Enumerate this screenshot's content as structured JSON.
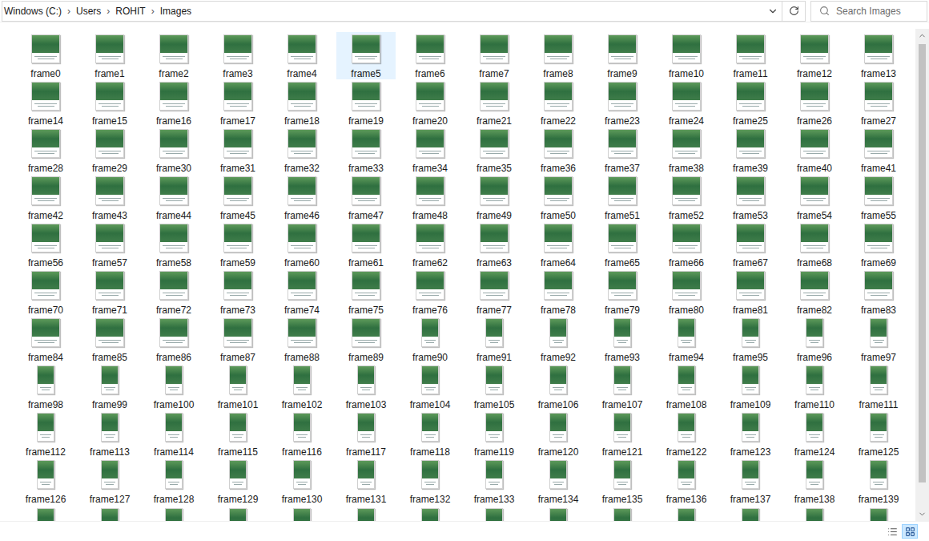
{
  "address_bar": {
    "path": [
      {
        "label": "Windows (C:)"
      },
      {
        "label": "Users"
      },
      {
        "label": "ROHIT"
      },
      {
        "label": "Images"
      }
    ],
    "separator": "›"
  },
  "search": {
    "placeholder": "Search Images"
  },
  "items": [
    {
      "name": "frame0",
      "kind": "landscape",
      "selected": false
    },
    {
      "name": "frame1",
      "kind": "landscape",
      "selected": false
    },
    {
      "name": "frame2",
      "kind": "landscape",
      "selected": false
    },
    {
      "name": "frame3",
      "kind": "landscape",
      "selected": false
    },
    {
      "name": "frame4",
      "kind": "landscape",
      "selected": false
    },
    {
      "name": "frame5",
      "kind": "landscape",
      "selected": true
    },
    {
      "name": "frame6",
      "kind": "landscape",
      "selected": false
    },
    {
      "name": "frame7",
      "kind": "landscape",
      "selected": false
    },
    {
      "name": "frame8",
      "kind": "landscape",
      "selected": false
    },
    {
      "name": "frame9",
      "kind": "landscape",
      "selected": false
    },
    {
      "name": "frame10",
      "kind": "landscape",
      "selected": false
    },
    {
      "name": "frame11",
      "kind": "landscape",
      "selected": false
    },
    {
      "name": "frame12",
      "kind": "landscape",
      "selected": false
    },
    {
      "name": "frame13",
      "kind": "landscape",
      "selected": false
    },
    {
      "name": "frame14",
      "kind": "landscape",
      "selected": false
    },
    {
      "name": "frame15",
      "kind": "landscape",
      "selected": false
    },
    {
      "name": "frame16",
      "kind": "landscape",
      "selected": false
    },
    {
      "name": "frame17",
      "kind": "landscape",
      "selected": false
    },
    {
      "name": "frame18",
      "kind": "landscape",
      "selected": false
    },
    {
      "name": "frame19",
      "kind": "landscape",
      "selected": false
    },
    {
      "name": "frame20",
      "kind": "landscape",
      "selected": false
    },
    {
      "name": "frame21",
      "kind": "landscape",
      "selected": false
    },
    {
      "name": "frame22",
      "kind": "landscape",
      "selected": false
    },
    {
      "name": "frame23",
      "kind": "landscape",
      "selected": false
    },
    {
      "name": "frame24",
      "kind": "landscape",
      "selected": false
    },
    {
      "name": "frame25",
      "kind": "landscape",
      "selected": false
    },
    {
      "name": "frame26",
      "kind": "landscape",
      "selected": false
    },
    {
      "name": "frame27",
      "kind": "landscape",
      "selected": false
    },
    {
      "name": "frame28",
      "kind": "landscape",
      "selected": false
    },
    {
      "name": "frame29",
      "kind": "landscape",
      "selected": false
    },
    {
      "name": "frame30",
      "kind": "landscape",
      "selected": false
    },
    {
      "name": "frame31",
      "kind": "landscape",
      "selected": false
    },
    {
      "name": "frame32",
      "kind": "landscape",
      "selected": false
    },
    {
      "name": "frame33",
      "kind": "landscape",
      "selected": false
    },
    {
      "name": "frame34",
      "kind": "landscape",
      "selected": false
    },
    {
      "name": "frame35",
      "kind": "landscape",
      "selected": false
    },
    {
      "name": "frame36",
      "kind": "landscape",
      "selected": false
    },
    {
      "name": "frame37",
      "kind": "landscape",
      "selected": false
    },
    {
      "name": "frame38",
      "kind": "landscape",
      "selected": false
    },
    {
      "name": "frame39",
      "kind": "landscape",
      "selected": false
    },
    {
      "name": "frame40",
      "kind": "landscape",
      "selected": false
    },
    {
      "name": "frame41",
      "kind": "landscape",
      "selected": false
    },
    {
      "name": "frame42",
      "kind": "landscape",
      "selected": false
    },
    {
      "name": "frame43",
      "kind": "landscape",
      "selected": false
    },
    {
      "name": "frame44",
      "kind": "landscape",
      "selected": false
    },
    {
      "name": "frame45",
      "kind": "landscape",
      "selected": false
    },
    {
      "name": "frame46",
      "kind": "landscape",
      "selected": false
    },
    {
      "name": "frame47",
      "kind": "landscape",
      "selected": false
    },
    {
      "name": "frame48",
      "kind": "landscape",
      "selected": false
    },
    {
      "name": "frame49",
      "kind": "landscape",
      "selected": false
    },
    {
      "name": "frame50",
      "kind": "landscape",
      "selected": false
    },
    {
      "name": "frame51",
      "kind": "landscape",
      "selected": false
    },
    {
      "name": "frame52",
      "kind": "landscape",
      "selected": false
    },
    {
      "name": "frame53",
      "kind": "landscape",
      "selected": false
    },
    {
      "name": "frame54",
      "kind": "landscape",
      "selected": false
    },
    {
      "name": "frame55",
      "kind": "landscape",
      "selected": false
    },
    {
      "name": "frame56",
      "kind": "landscape",
      "selected": false
    },
    {
      "name": "frame57",
      "kind": "landscape",
      "selected": false
    },
    {
      "name": "frame58",
      "kind": "landscape",
      "selected": false
    },
    {
      "name": "frame59",
      "kind": "landscape",
      "selected": false
    },
    {
      "name": "frame60",
      "kind": "landscape",
      "selected": false
    },
    {
      "name": "frame61",
      "kind": "landscape",
      "selected": false
    },
    {
      "name": "frame62",
      "kind": "landscape",
      "selected": false
    },
    {
      "name": "frame63",
      "kind": "landscape",
      "selected": false
    },
    {
      "name": "frame64",
      "kind": "landscape",
      "selected": false
    },
    {
      "name": "frame65",
      "kind": "landscape",
      "selected": false
    },
    {
      "name": "frame66",
      "kind": "landscape",
      "selected": false
    },
    {
      "name": "frame67",
      "kind": "landscape",
      "selected": false
    },
    {
      "name": "frame68",
      "kind": "landscape",
      "selected": false
    },
    {
      "name": "frame69",
      "kind": "landscape",
      "selected": false
    },
    {
      "name": "frame70",
      "kind": "landscape",
      "selected": false
    },
    {
      "name": "frame71",
      "kind": "landscape",
      "selected": false
    },
    {
      "name": "frame72",
      "kind": "landscape",
      "selected": false
    },
    {
      "name": "frame73",
      "kind": "landscape",
      "selected": false
    },
    {
      "name": "frame74",
      "kind": "landscape",
      "selected": false
    },
    {
      "name": "frame75",
      "kind": "landscape",
      "selected": false
    },
    {
      "name": "frame76",
      "kind": "landscape",
      "selected": false
    },
    {
      "name": "frame77",
      "kind": "landscape",
      "selected": false
    },
    {
      "name": "frame78",
      "kind": "landscape",
      "selected": false
    },
    {
      "name": "frame79",
      "kind": "landscape",
      "selected": false
    },
    {
      "name": "frame80",
      "kind": "landscape",
      "selected": false
    },
    {
      "name": "frame81",
      "kind": "landscape",
      "selected": false
    },
    {
      "name": "frame82",
      "kind": "landscape",
      "selected": false
    },
    {
      "name": "frame83",
      "kind": "landscape",
      "selected": false
    },
    {
      "name": "frame84",
      "kind": "landscape",
      "selected": false
    },
    {
      "name": "frame85",
      "kind": "landscape",
      "selected": false
    },
    {
      "name": "frame86",
      "kind": "landscape",
      "selected": false
    },
    {
      "name": "frame87",
      "kind": "landscape",
      "selected": false
    },
    {
      "name": "frame88",
      "kind": "landscape",
      "selected": false
    },
    {
      "name": "frame89",
      "kind": "landscape",
      "selected": false
    },
    {
      "name": "frame90",
      "kind": "portrait",
      "selected": false
    },
    {
      "name": "frame91",
      "kind": "portrait",
      "selected": false
    },
    {
      "name": "frame92",
      "kind": "portrait",
      "selected": false
    },
    {
      "name": "frame93",
      "kind": "portrait",
      "selected": false
    },
    {
      "name": "frame94",
      "kind": "portrait",
      "selected": false
    },
    {
      "name": "frame95",
      "kind": "portrait",
      "selected": false
    },
    {
      "name": "frame96",
      "kind": "portrait",
      "selected": false
    },
    {
      "name": "frame97",
      "kind": "portrait",
      "selected": false
    },
    {
      "name": "frame98",
      "kind": "portrait",
      "selected": false
    },
    {
      "name": "frame99",
      "kind": "portrait",
      "selected": false
    },
    {
      "name": "frame100",
      "kind": "portrait",
      "selected": false
    },
    {
      "name": "frame101",
      "kind": "portrait",
      "selected": false
    },
    {
      "name": "frame102",
      "kind": "portrait",
      "selected": false
    },
    {
      "name": "frame103",
      "kind": "portrait",
      "selected": false
    },
    {
      "name": "frame104",
      "kind": "portrait",
      "selected": false
    },
    {
      "name": "frame105",
      "kind": "portrait",
      "selected": false
    },
    {
      "name": "frame106",
      "kind": "portrait",
      "selected": false
    },
    {
      "name": "frame107",
      "kind": "portrait",
      "selected": false
    },
    {
      "name": "frame108",
      "kind": "portrait",
      "selected": false
    },
    {
      "name": "frame109",
      "kind": "portrait",
      "selected": false
    },
    {
      "name": "frame110",
      "kind": "portrait",
      "selected": false
    },
    {
      "name": "frame111",
      "kind": "portrait",
      "selected": false
    },
    {
      "name": "frame112",
      "kind": "portrait",
      "selected": false
    },
    {
      "name": "frame113",
      "kind": "portrait",
      "selected": false
    },
    {
      "name": "frame114",
      "kind": "portrait",
      "selected": false
    },
    {
      "name": "frame115",
      "kind": "portrait",
      "selected": false
    },
    {
      "name": "frame116",
      "kind": "portrait",
      "selected": false
    },
    {
      "name": "frame117",
      "kind": "portrait",
      "selected": false
    },
    {
      "name": "frame118",
      "kind": "portrait",
      "selected": false
    },
    {
      "name": "frame119",
      "kind": "portrait",
      "selected": false
    },
    {
      "name": "frame120",
      "kind": "portrait",
      "selected": false
    },
    {
      "name": "frame121",
      "kind": "portrait",
      "selected": false
    },
    {
      "name": "frame122",
      "kind": "portrait",
      "selected": false
    },
    {
      "name": "frame123",
      "kind": "portrait",
      "selected": false
    },
    {
      "name": "frame124",
      "kind": "portrait",
      "selected": false
    },
    {
      "name": "frame125",
      "kind": "portrait",
      "selected": false
    },
    {
      "name": "frame126",
      "kind": "portrait",
      "selected": false
    },
    {
      "name": "frame127",
      "kind": "portrait",
      "selected": false
    },
    {
      "name": "frame128",
      "kind": "portrait",
      "selected": false
    },
    {
      "name": "frame129",
      "kind": "portrait",
      "selected": false
    },
    {
      "name": "frame130",
      "kind": "portrait",
      "selected": false
    },
    {
      "name": "frame131",
      "kind": "portrait",
      "selected": false
    },
    {
      "name": "frame132",
      "kind": "portrait",
      "selected": false
    },
    {
      "name": "frame133",
      "kind": "portrait",
      "selected": false
    },
    {
      "name": "frame134",
      "kind": "portrait",
      "selected": false
    },
    {
      "name": "frame135",
      "kind": "portrait",
      "selected": false
    },
    {
      "name": "frame136",
      "kind": "portrait",
      "selected": false
    },
    {
      "name": "frame137",
      "kind": "portrait",
      "selected": false
    },
    {
      "name": "frame138",
      "kind": "portrait",
      "selected": false
    },
    {
      "name": "frame139",
      "kind": "portrait",
      "selected": false
    },
    {
      "name": "",
      "kind": "portrait",
      "selected": false
    },
    {
      "name": "",
      "kind": "portrait",
      "selected": false
    },
    {
      "name": "",
      "kind": "portrait",
      "selected": false
    },
    {
      "name": "",
      "kind": "portrait",
      "selected": false
    },
    {
      "name": "",
      "kind": "portrait",
      "selected": false
    },
    {
      "name": "",
      "kind": "portrait",
      "selected": false
    },
    {
      "name": "",
      "kind": "portrait",
      "selected": false
    },
    {
      "name": "",
      "kind": "portrait",
      "selected": false
    },
    {
      "name": "",
      "kind": "portrait",
      "selected": false
    },
    {
      "name": "",
      "kind": "portrait",
      "selected": false
    },
    {
      "name": "",
      "kind": "portrait",
      "selected": false
    },
    {
      "name": "",
      "kind": "portrait",
      "selected": false
    },
    {
      "name": "",
      "kind": "portrait",
      "selected": false
    },
    {
      "name": "",
      "kind": "portrait",
      "selected": false
    }
  ],
  "scrollbar": {
    "level": 0.95
  },
  "status_bar": {
    "views": [
      {
        "kind": "details",
        "selected": false
      },
      {
        "kind": "large-icons",
        "selected": true
      }
    ]
  }
}
